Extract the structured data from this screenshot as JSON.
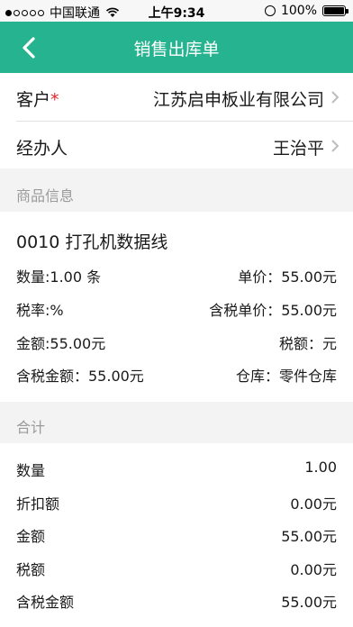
{
  "status_bar": {
    "carrier": "中国联通",
    "time": "上午9:34",
    "battery": "100%"
  },
  "nav": {
    "title": "销售出库单"
  },
  "customer": {
    "label": "客户",
    "required_mark": "*",
    "value": "江苏启申板业有限公司"
  },
  "handler": {
    "label": "经办人",
    "value": "王治平"
  },
  "goods_section": {
    "header": "商品信息"
  },
  "item": {
    "title": "0010 打孔机数据线",
    "quantity": "数量:1.00 条",
    "unit_price": "单价：55.00元",
    "tax_rate": "税率:%",
    "tax_incl_unit_price": "含税单价：55.00元",
    "amount": "金额:55.00元",
    "tax": "税额：元",
    "tax_incl_amount": "含税金额：55.00元",
    "warehouse": "仓库：零件仓库"
  },
  "totals_section": {
    "header": "合计",
    "rows": [
      {
        "label": "数量",
        "value": "1.00"
      },
      {
        "label": "折扣额",
        "value": "0.00元"
      },
      {
        "label": "金额",
        "value": "55.00元"
      },
      {
        "label": "税额",
        "value": "0.00元"
      },
      {
        "label": "含税金额",
        "value": "55.00元"
      }
    ]
  }
}
